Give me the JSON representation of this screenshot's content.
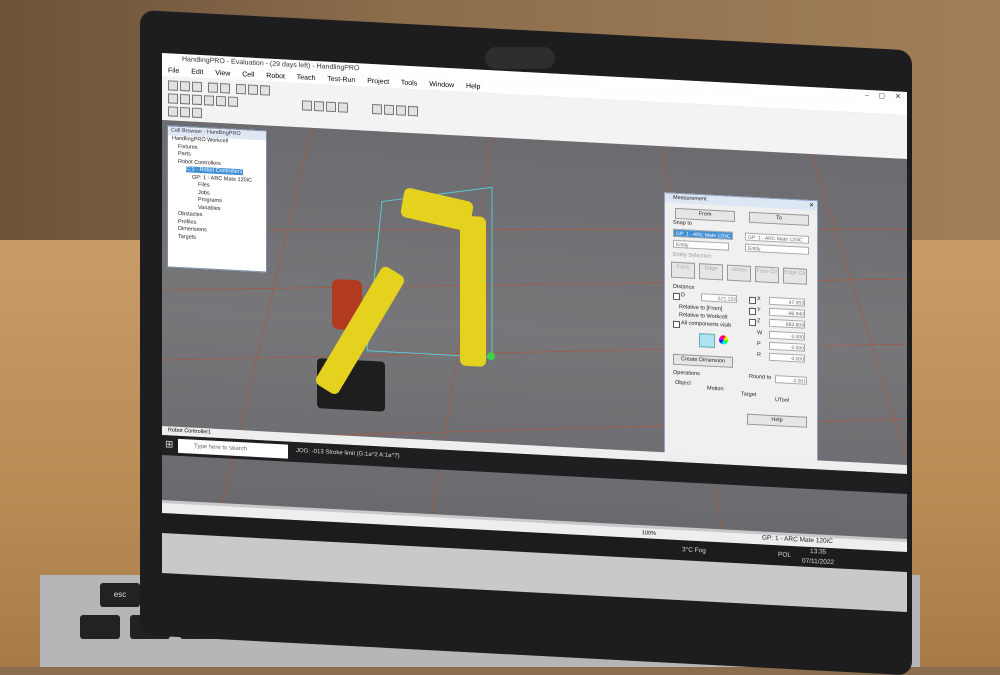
{
  "app": {
    "title": "HandlingPRO - Evaluation - (29 days left) - HandlingPRO",
    "menu": [
      "File",
      "Edit",
      "View",
      "Cell",
      "Robot",
      "Teach",
      "Test-Run",
      "Project",
      "Tools",
      "Window",
      "Help"
    ]
  },
  "cell_browser": {
    "title": "Cell Browser - HandlingPRO",
    "items": [
      "HandlingPRO Workcell",
      "Fixtures",
      "Parts",
      "Robot Controllers",
      "C:1 - Robot Controller1",
      "GP: 1 - ARC Mate 120iC",
      "Files",
      "Jobs",
      "Programs",
      "Variables",
      "Obstacles",
      "Profiles",
      "Dimensions",
      "Targets"
    ]
  },
  "measurement": {
    "title": "Measurement",
    "from_label": "From",
    "to_label": "To",
    "snap_to_label": "Snap to",
    "from_value": "GP: 1 - ARC Mate 120iC",
    "to_value": "GP: 1 - ARC Mate 120iC",
    "entity_from": "Entity",
    "entity_to": "Entity",
    "entity_selection_label": "Entity Selection",
    "entity_buttons": [
      "Face",
      "Edge",
      "Vertex",
      "Face Ctr",
      "Edge Ctr"
    ],
    "distance_label": "Distance",
    "d_label": "D",
    "d_value": "571.122",
    "relative_from": "Relative to [From]",
    "relative_workcell": "Relative to Workcell",
    "all_components": "All components visib",
    "x_label": "X",
    "x_value": "47.353",
    "y_label": "Y",
    "y_value": "-96.940",
    "z_label": "Z",
    "z_value": "883.809",
    "w_label": "W",
    "w_value": "0.000",
    "p_label": "P",
    "p_value": "0.000",
    "r_label": "R",
    "r_value": "0.000",
    "create_dimension": "Create Dimension",
    "round_to_label": "Round to",
    "round_to_value": "0.001",
    "operations_label": "Operations",
    "op_object": "Object",
    "op_motion": "Motion",
    "op_target": "Target",
    "op_utool": "UTool",
    "help": "Help"
  },
  "status": {
    "controller": "Robot Controller1",
    "jog_text": "JOG: -013 Stroke limit (G:1a^2 A:1a^7)",
    "zoom": "100%",
    "gp_status": "GP: 1 - ARC Mate 120iC"
  },
  "taskbar": {
    "search_placeholder": "Type here to search",
    "weather": "3°C Fog",
    "lang": "POL",
    "time": "13:35",
    "date": "07/11/2022"
  },
  "laptop": {
    "brand": "hp"
  },
  "colors": {
    "robot_yellow": "#e4d21f",
    "viewport_gray": "#707074",
    "selection_blue": "#3d8fd6",
    "grid_red": "#b4502f"
  }
}
